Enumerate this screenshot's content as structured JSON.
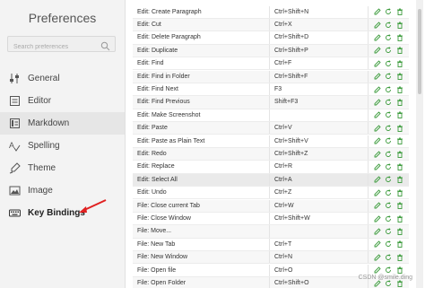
{
  "sidebar": {
    "title": "Preferences",
    "search_placeholder": "Search preferences",
    "items": [
      {
        "label": "General",
        "icon": "sliders-icon"
      },
      {
        "label": "Editor",
        "icon": "editor-icon"
      },
      {
        "label": "Markdown",
        "icon": "markdown-icon"
      },
      {
        "label": "Spelling",
        "icon": "spelling-icon"
      },
      {
        "label": "Theme",
        "icon": "theme-icon"
      },
      {
        "label": "Image",
        "icon": "image-icon"
      },
      {
        "label": "Key Bindings",
        "icon": "keyboard-icon"
      }
    ],
    "active_index": 2
  },
  "bindings": [
    {
      "command": "Edit: Create Paragraph",
      "keys": "Ctrl+Shift+N"
    },
    {
      "command": "Edit: Cut",
      "keys": "Ctrl+X"
    },
    {
      "command": "Edit: Delete Paragraph",
      "keys": "Ctrl+Shift+D"
    },
    {
      "command": "Edit: Duplicate",
      "keys": "Ctrl+Shift+P"
    },
    {
      "command": "Edit: Find",
      "keys": "Ctrl+F"
    },
    {
      "command": "Edit: Find in Folder",
      "keys": "Ctrl+Shift+F"
    },
    {
      "command": "Edit: Find Next",
      "keys": "F3"
    },
    {
      "command": "Edit: Find Previous",
      "keys": "Shift+F3"
    },
    {
      "command": "Edit: Make Screenshot",
      "keys": ""
    },
    {
      "command": "Edit: Paste",
      "keys": "Ctrl+V"
    },
    {
      "command": "Edit: Paste as Plain Text",
      "keys": "Ctrl+Shift+V"
    },
    {
      "command": "Edit: Redo",
      "keys": "Ctrl+Shift+Z"
    },
    {
      "command": "Edit: Replace",
      "keys": "Ctrl+R"
    },
    {
      "command": "Edit: Select All",
      "keys": "Ctrl+A"
    },
    {
      "command": "Edit: Undo",
      "keys": "Ctrl+Z"
    },
    {
      "command": "File: Close current Tab",
      "keys": "Ctrl+W"
    },
    {
      "command": "File: Close Window",
      "keys": "Ctrl+Shift+W"
    },
    {
      "command": "File: Move...",
      "keys": ""
    },
    {
      "command": "File: New Tab",
      "keys": "Ctrl+T"
    },
    {
      "command": "File: New Window",
      "keys": "Ctrl+N"
    },
    {
      "command": "File: Open file",
      "keys": "Ctrl+O"
    },
    {
      "command": "File: Open Folder",
      "keys": "Ctrl+Shift+O"
    }
  ],
  "selected_row_index": 13,
  "watermark": "CSDN @smile.ding",
  "colors": {
    "edit_icon": "#3a9a3a",
    "reset_icon": "#3a9a3a",
    "delete_icon": "#3a9a3a",
    "arrow": "#e02020"
  }
}
